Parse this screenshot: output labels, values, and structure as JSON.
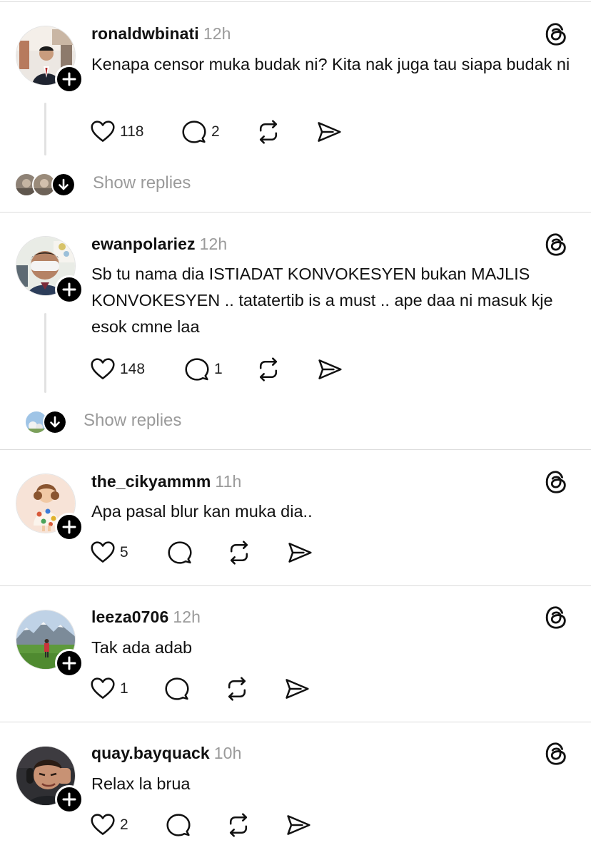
{
  "colors": {
    "text": "#111111",
    "muted": "#9a9a9a",
    "separator": "#dcdcdc",
    "follow_badge": "#000000"
  },
  "posts": [
    {
      "username": "ronaldwbinati",
      "time": "12h",
      "text": "Kenapa censor muka budak ni? Kita nak juga tau siapa budak ni",
      "likes": "118",
      "replies": "2",
      "show_replies_label": "Show replies"
    },
    {
      "username": "ewanpolariez",
      "time": "12h",
      "text": "Sb tu nama dia ISTIADAT KONVOKESYEN bukan MAJLIS KONVOKESYEN .. tatatertib is a must .. ape daa ni masuk kje esok cmne laa",
      "likes": "148",
      "replies": "1",
      "show_replies_label": "Show replies"
    },
    {
      "username": "the_cikyammm",
      "time": "11h",
      "text": "Apa pasal blur kan muka dia..",
      "likes": "5",
      "replies": ""
    },
    {
      "username": "leeza0706",
      "time": "12h",
      "text": "Tak ada adab",
      "likes": "1",
      "replies": ""
    },
    {
      "username": "quay.bayquack",
      "time": "10h",
      "text": "Relax la brua",
      "likes": "2",
      "replies": ""
    }
  ],
  "icons": {
    "like": "heart-icon",
    "reply": "comment-icon",
    "repost": "repost-icon",
    "share": "send-icon",
    "brand": "threads-logo-icon",
    "follow": "plus-icon"
  }
}
